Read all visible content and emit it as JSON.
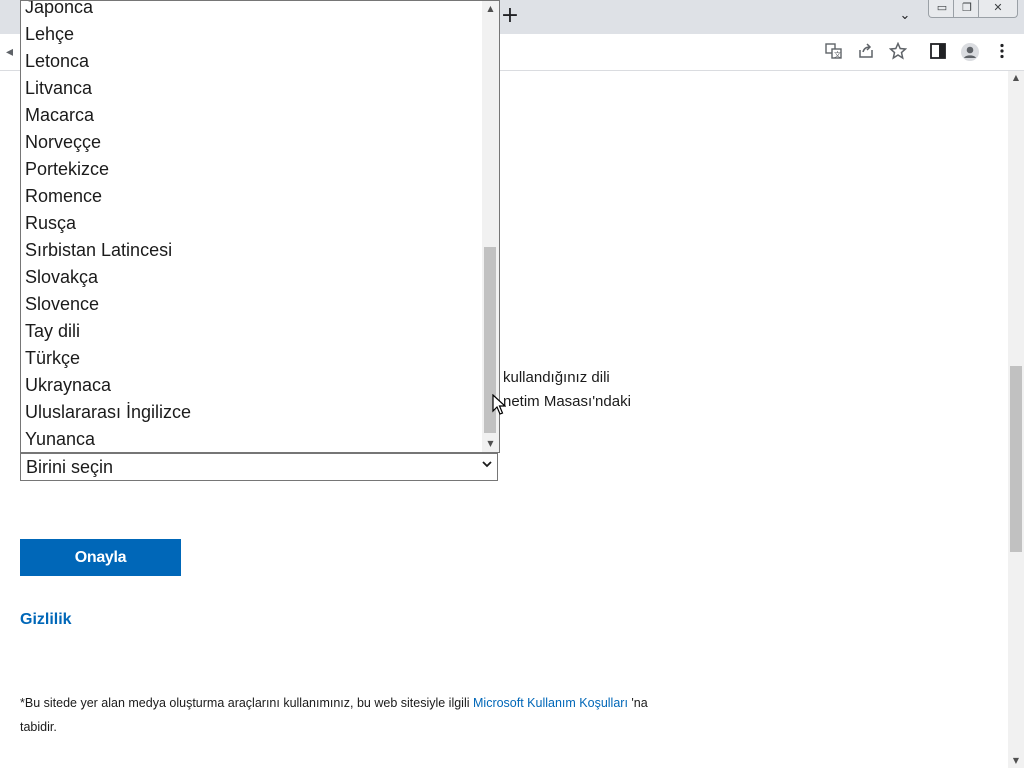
{
  "browser": {
    "new_tab_glyph": "+",
    "tab_search_glyph": "⌄",
    "window_controls": {
      "minimize": "▭",
      "maximize": "❐",
      "close": "✕"
    },
    "toolbar_icons": [
      "translate-icon",
      "share-icon",
      "bookmark-star-icon",
      "side-panel-icon",
      "profile-icon",
      "menu-icon"
    ]
  },
  "dropdown": {
    "options": [
      "Japonca",
      "Lehçe",
      "Letonca",
      "Litvanca",
      "Macarca",
      "Norveççe",
      "Portekizce",
      "Romence",
      "Rusça",
      "Sırbistan Latincesi",
      "Slovakça",
      "Slovence",
      "Tay dili",
      "Türkçe",
      "Ukraynaca",
      "Uluslararası İngilizce",
      "Yunanca"
    ],
    "selected": "Birini seçin"
  },
  "partial_text": {
    "line1": "kullandığınız dili",
    "line2": "netim Masası'ndaki"
  },
  "confirm_button": "Onayla",
  "privacy_link": "Gizlilik",
  "footnote": {
    "before_link": "*Bu sitede yer alan medya oluşturma araçlarını kullanımınız, bu web sitesiyle ilgili ",
    "link": "Microsoft Kullanım Koşulları",
    "after_link": " 'na tabidir."
  },
  "colors": {
    "accent": "#0067b8",
    "tabstrip": "#dee1e6"
  }
}
